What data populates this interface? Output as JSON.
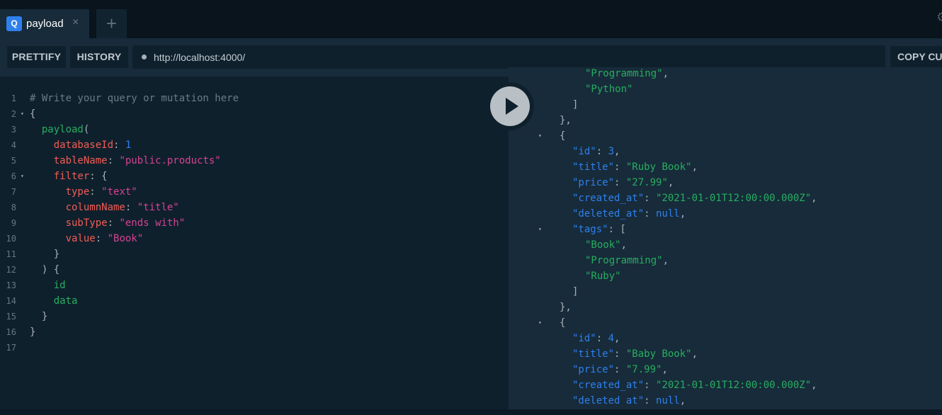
{
  "tab": {
    "logo": "Q",
    "title": "payload",
    "close": "×",
    "add": "+"
  },
  "toolbar": {
    "prettify": "PRETTIFY",
    "history": "HISTORY",
    "url": "http://localhost:4000/",
    "copy_curl": "COPY CURL"
  },
  "editor": {
    "lines": [
      {
        "n": "1",
        "fold": "",
        "tokens": [
          [
            "c-comment",
            "# Write your query or mutation here"
          ]
        ]
      },
      {
        "n": "2",
        "fold": "▾",
        "tokens": [
          [
            "c-punc",
            "{"
          ]
        ]
      },
      {
        "n": "3",
        "fold": "",
        "tokens": [
          [
            "c-punc",
            "  "
          ],
          [
            "c-field",
            "payload"
          ],
          [
            "c-punc",
            "("
          ]
        ]
      },
      {
        "n": "4",
        "fold": "",
        "tokens": [
          [
            "c-punc",
            "    "
          ],
          [
            "c-arg",
            "databaseId"
          ],
          [
            "c-punc",
            ": "
          ],
          [
            "c-num",
            "1"
          ]
        ]
      },
      {
        "n": "5",
        "fold": "",
        "tokens": [
          [
            "c-punc",
            "    "
          ],
          [
            "c-arg",
            "tableName"
          ],
          [
            "c-punc",
            ": "
          ],
          [
            "c-str",
            "\"public.products\""
          ]
        ]
      },
      {
        "n": "6",
        "fold": "▾",
        "tokens": [
          [
            "c-punc",
            "    "
          ],
          [
            "c-arg",
            "filter"
          ],
          [
            "c-punc",
            ": {"
          ]
        ]
      },
      {
        "n": "7",
        "fold": "",
        "tokens": [
          [
            "c-punc",
            "      "
          ],
          [
            "c-arg",
            "type"
          ],
          [
            "c-punc",
            ": "
          ],
          [
            "c-str",
            "\"text\""
          ]
        ]
      },
      {
        "n": "8",
        "fold": "",
        "tokens": [
          [
            "c-punc",
            "      "
          ],
          [
            "c-arg",
            "columnName"
          ],
          [
            "c-punc",
            ": "
          ],
          [
            "c-str",
            "\"title\""
          ]
        ]
      },
      {
        "n": "9",
        "fold": "",
        "tokens": [
          [
            "c-punc",
            "      "
          ],
          [
            "c-arg",
            "subType"
          ],
          [
            "c-punc",
            ": "
          ],
          [
            "c-str",
            "\"ends with\""
          ]
        ]
      },
      {
        "n": "10",
        "fold": "",
        "tokens": [
          [
            "c-punc",
            "      "
          ],
          [
            "c-arg",
            "value"
          ],
          [
            "c-punc",
            ": "
          ],
          [
            "c-str",
            "\"Book\""
          ]
        ]
      },
      {
        "n": "11",
        "fold": "",
        "tokens": [
          [
            "c-punc",
            "    }"
          ]
        ]
      },
      {
        "n": "12",
        "fold": "",
        "tokens": [
          [
            "c-punc",
            "  ) {"
          ]
        ]
      },
      {
        "n": "13",
        "fold": "",
        "tokens": [
          [
            "c-punc",
            "    "
          ],
          [
            "c-field",
            "id"
          ]
        ]
      },
      {
        "n": "14",
        "fold": "",
        "tokens": [
          [
            "c-punc",
            "    "
          ],
          [
            "c-field",
            "data"
          ]
        ]
      },
      {
        "n": "15",
        "fold": "",
        "tokens": [
          [
            "c-punc",
            "  }"
          ]
        ]
      },
      {
        "n": "16",
        "fold": "",
        "tokens": [
          [
            "c-punc",
            "}"
          ]
        ]
      },
      {
        "n": "17",
        "fold": "",
        "tokens": []
      }
    ]
  },
  "result": {
    "lines": [
      {
        "fold": "",
        "indent": 9,
        "tokens": [
          [
            "j-str",
            "\"Programming\""
          ],
          [
            "j-punc",
            ","
          ]
        ]
      },
      {
        "fold": "",
        "indent": 9,
        "tokens": [
          [
            "j-str",
            "\"Python\""
          ]
        ]
      },
      {
        "fold": "",
        "indent": 8,
        "tokens": [
          [
            "j-punc",
            "]"
          ]
        ]
      },
      {
        "fold": "",
        "indent": 7,
        "tokens": [
          [
            "j-punc",
            "},"
          ]
        ]
      },
      {
        "fold": "▾",
        "indent": 7,
        "tokens": [
          [
            "j-punc",
            "{"
          ]
        ]
      },
      {
        "fold": "",
        "indent": 8,
        "tokens": [
          [
            "j-key",
            "\"id\""
          ],
          [
            "j-punc",
            ": "
          ],
          [
            "j-num",
            "3"
          ],
          [
            "j-punc",
            ","
          ]
        ]
      },
      {
        "fold": "",
        "indent": 8,
        "tokens": [
          [
            "j-key",
            "\"title\""
          ],
          [
            "j-punc",
            ": "
          ],
          [
            "j-str",
            "\"Ruby Book\""
          ],
          [
            "j-punc",
            ","
          ]
        ]
      },
      {
        "fold": "",
        "indent": 8,
        "tokens": [
          [
            "j-key",
            "\"price\""
          ],
          [
            "j-punc",
            ": "
          ],
          [
            "j-str",
            "\"27.99\""
          ],
          [
            "j-punc",
            ","
          ]
        ]
      },
      {
        "fold": "",
        "indent": 8,
        "tokens": [
          [
            "j-key",
            "\"created_at\""
          ],
          [
            "j-punc",
            ": "
          ],
          [
            "j-str",
            "\"2021-01-01T12:00:00.000Z\""
          ],
          [
            "j-punc",
            ","
          ]
        ]
      },
      {
        "fold": "",
        "indent": 8,
        "tokens": [
          [
            "j-key",
            "\"deleted_at\""
          ],
          [
            "j-punc",
            ": "
          ],
          [
            "j-null",
            "null"
          ],
          [
            "j-punc",
            ","
          ]
        ]
      },
      {
        "fold": "▾",
        "indent": 8,
        "tokens": [
          [
            "j-key",
            "\"tags\""
          ],
          [
            "j-punc",
            ": ["
          ]
        ]
      },
      {
        "fold": "",
        "indent": 9,
        "tokens": [
          [
            "j-str",
            "\"Book\""
          ],
          [
            "j-punc",
            ","
          ]
        ]
      },
      {
        "fold": "",
        "indent": 9,
        "tokens": [
          [
            "j-str",
            "\"Programming\""
          ],
          [
            "j-punc",
            ","
          ]
        ]
      },
      {
        "fold": "",
        "indent": 9,
        "tokens": [
          [
            "j-str",
            "\"Ruby\""
          ]
        ]
      },
      {
        "fold": "",
        "indent": 8,
        "tokens": [
          [
            "j-punc",
            "]"
          ]
        ]
      },
      {
        "fold": "",
        "indent": 7,
        "tokens": [
          [
            "j-punc",
            "},"
          ]
        ]
      },
      {
        "fold": "▾",
        "indent": 7,
        "tokens": [
          [
            "j-punc",
            "{"
          ]
        ]
      },
      {
        "fold": "",
        "indent": 8,
        "tokens": [
          [
            "j-key",
            "\"id\""
          ],
          [
            "j-punc",
            ": "
          ],
          [
            "j-num",
            "4"
          ],
          [
            "j-punc",
            ","
          ]
        ]
      },
      {
        "fold": "",
        "indent": 8,
        "tokens": [
          [
            "j-key",
            "\"title\""
          ],
          [
            "j-punc",
            ": "
          ],
          [
            "j-str",
            "\"Baby Book\""
          ],
          [
            "j-punc",
            ","
          ]
        ]
      },
      {
        "fold": "",
        "indent": 8,
        "tokens": [
          [
            "j-key",
            "\"price\""
          ],
          [
            "j-punc",
            ": "
          ],
          [
            "j-str",
            "\"7.99\""
          ],
          [
            "j-punc",
            ","
          ]
        ]
      },
      {
        "fold": "",
        "indent": 8,
        "tokens": [
          [
            "j-key",
            "\"created_at\""
          ],
          [
            "j-punc",
            ": "
          ],
          [
            "j-str",
            "\"2021-01-01T12:00:00.000Z\""
          ],
          [
            "j-punc",
            ","
          ]
        ]
      },
      {
        "fold": "",
        "indent": 8,
        "tokens": [
          [
            "j-key",
            "\"deleted at\""
          ],
          [
            "j-punc",
            ": "
          ],
          [
            "j-null",
            "null"
          ],
          [
            "j-punc",
            ","
          ]
        ]
      }
    ]
  },
  "colors": {
    "background": "#0f202d",
    "result_background": "#172b3a",
    "tab_bar": "#09141c",
    "field_green": "#27ae60",
    "argument_red": "#f25c54",
    "string_pink": "#d64292",
    "number_blue": "#2f80ed"
  },
  "icons": {
    "logo": "graphql-playground-logo",
    "close": "close-icon",
    "add": "plus-icon",
    "run": "play-icon",
    "settings": "gear-icon"
  }
}
